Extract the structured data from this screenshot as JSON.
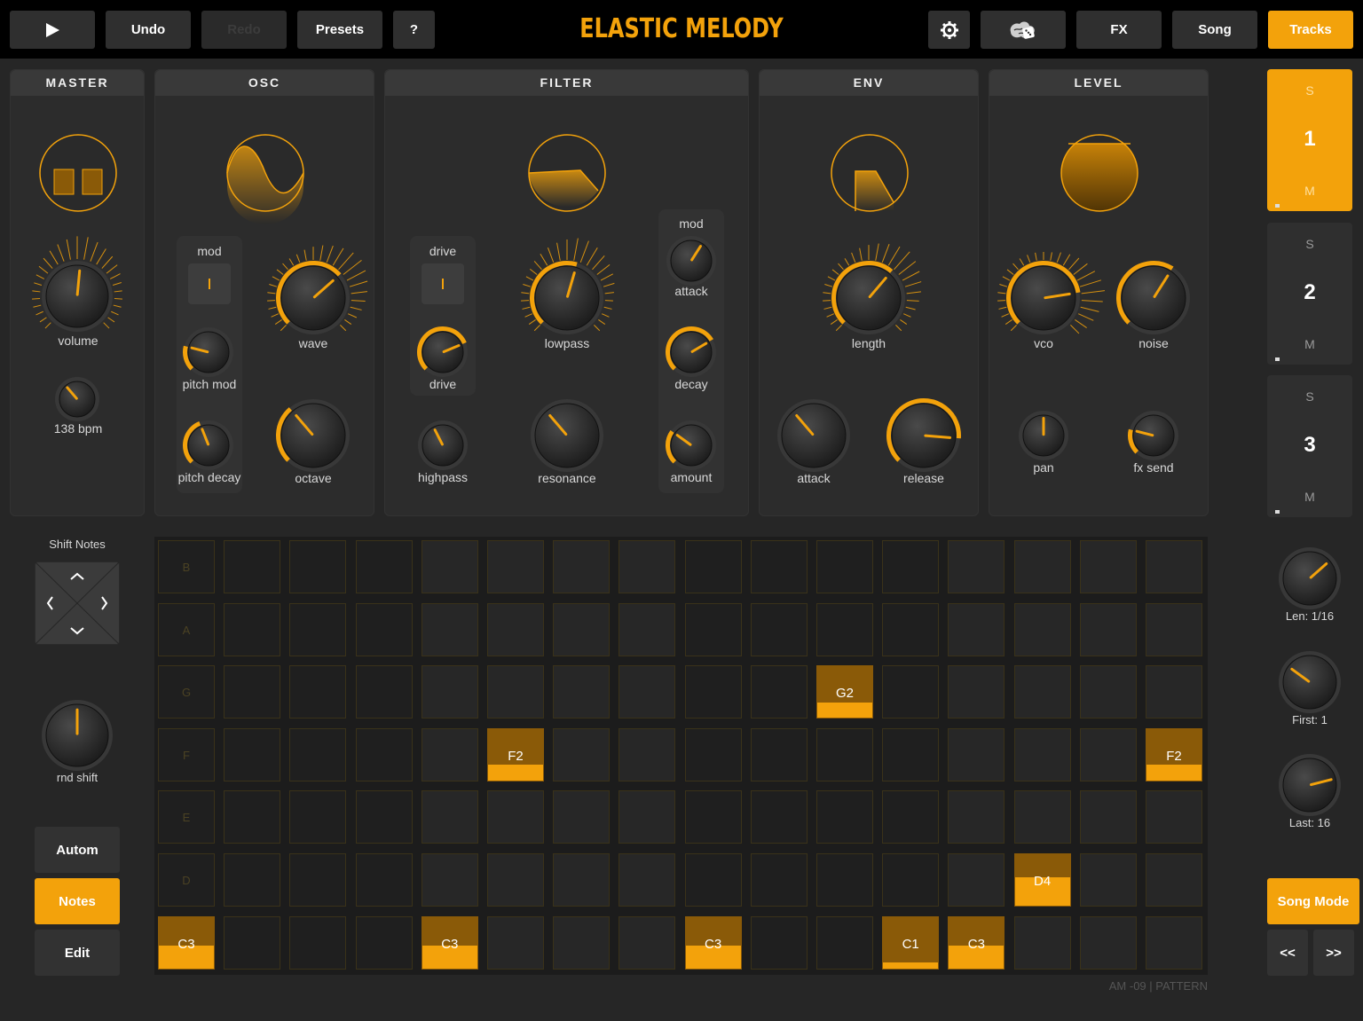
{
  "header": {
    "title": "ELASTIC MELODY",
    "play_icon": "play-icon",
    "undo": "Undo",
    "redo": "Redo",
    "presets": "Presets",
    "help": "?",
    "settings_icon": "gear-icon",
    "randomize_icon": "brain-dice-icon",
    "fx": "FX",
    "song": "Song",
    "tracks": "Tracks"
  },
  "panels": {
    "master": {
      "title": "MASTER",
      "volume": "volume",
      "bpm": "138 bpm"
    },
    "osc": {
      "title": "OSC",
      "mod": "mod",
      "pitch_mod": "pitch mod",
      "pitch_decay": "pitch decay",
      "wave": "wave",
      "octave": "octave"
    },
    "filter": {
      "title": "FILTER",
      "drive_group": "drive",
      "drive": "drive",
      "highpass": "highpass",
      "lowpass": "lowpass",
      "resonance": "resonance",
      "mod": "mod",
      "attack": "attack",
      "decay": "decay",
      "amount": "amount"
    },
    "env": {
      "title": "ENV",
      "length": "length",
      "attack": "attack",
      "release": "release"
    },
    "level": {
      "title": "LEVEL",
      "vco": "vco",
      "noise": "noise",
      "pan": "pan",
      "fx_send": "fx send"
    }
  },
  "tracks": [
    {
      "s": "S",
      "num": "1",
      "m": "M"
    },
    {
      "s": "S",
      "num": "2",
      "m": "M"
    },
    {
      "s": "S",
      "num": "3",
      "m": "M"
    }
  ],
  "sequencer": {
    "shift_notes": "Shift Notes",
    "rnd_shift": "rnd shift",
    "modes": {
      "autom": "Autom",
      "notes": "Notes",
      "edit": "Edit"
    },
    "rows": [
      "B",
      "A",
      "G",
      "F",
      "E",
      "D"
    ],
    "notes": [
      {
        "row": 6,
        "col": 0,
        "label": "C3",
        "level": 0.45
      },
      {
        "row": 6,
        "col": 4,
        "label": "C3",
        "level": 0.45
      },
      {
        "row": 6,
        "col": 8,
        "label": "C3",
        "level": 0.45
      },
      {
        "row": 6,
        "col": 11,
        "label": "C1",
        "level": 0.12
      },
      {
        "row": 6,
        "col": 12,
        "label": "C3",
        "level": 0.45
      },
      {
        "row": 3,
        "col": 5,
        "label": "F2",
        "level": 0.3
      },
      {
        "row": 3,
        "col": 15,
        "label": "F2",
        "level": 0.3
      },
      {
        "row": 2,
        "col": 10,
        "label": "G2",
        "level": 0.3
      },
      {
        "row": 5,
        "col": 13,
        "label": "D4",
        "level": 0.55
      }
    ],
    "footer": "AM -09  |  PATTERN",
    "len": "Len: 1/16",
    "first": "First: 1",
    "last": "Last: 16",
    "song_mode": "Song Mode",
    "prev": "<<",
    "next": ">>"
  },
  "colors": {
    "accent": "#f3a20b",
    "background": "#262626",
    "panel": "#2c2c2c"
  }
}
